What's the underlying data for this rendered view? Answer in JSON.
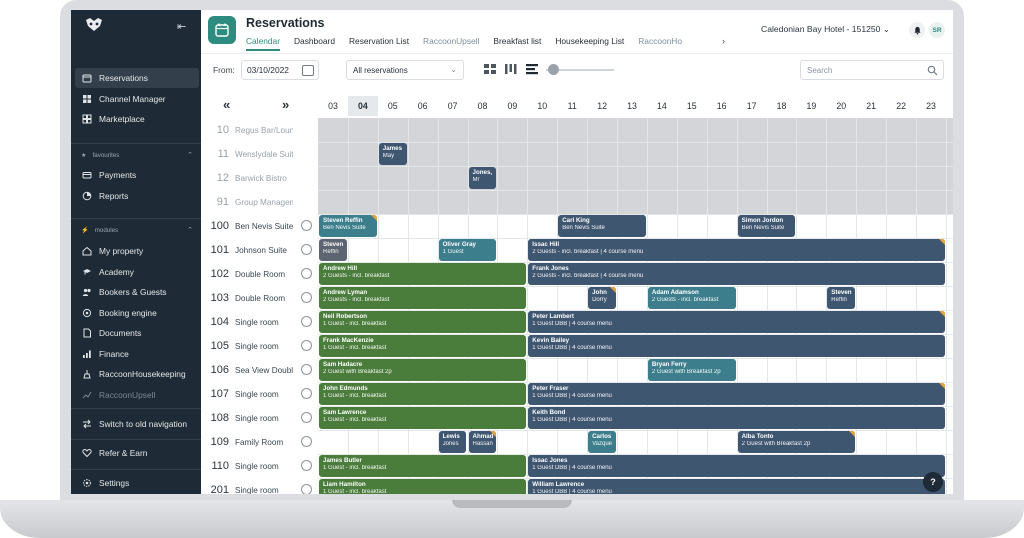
{
  "sidebar": {
    "nav": [
      {
        "label": "Reservations",
        "icon": "reservations-icon",
        "active": true
      },
      {
        "label": "Channel Manager",
        "icon": "channel-icon"
      },
      {
        "label": "Marketplace",
        "icon": "marketplace-icon"
      }
    ],
    "favourites_label": "favourites",
    "favourites": [
      {
        "label": "Payments",
        "icon": "payments-icon"
      },
      {
        "label": "Reports",
        "icon": "reports-icon"
      }
    ],
    "modules_label": "modules",
    "modules": [
      {
        "label": "My property",
        "icon": "property-icon"
      },
      {
        "label": "Academy",
        "icon": "academy-icon"
      },
      {
        "label": "Bookers & Guests",
        "icon": "guests-icon"
      },
      {
        "label": "Booking engine",
        "icon": "engine-icon"
      },
      {
        "label": "Documents",
        "icon": "documents-icon"
      },
      {
        "label": "Finance",
        "icon": "finance-icon"
      },
      {
        "label": "RaccoonHousekeeping",
        "icon": "housekeeping-icon"
      },
      {
        "label": "RaccoonUpsell",
        "icon": "upsell-icon",
        "dim": true
      }
    ],
    "footer": [
      {
        "label": "Switch to old navigation",
        "icon": "switch-icon"
      },
      {
        "label": "Refer & Earn",
        "icon": "heart-icon"
      },
      {
        "label": "Settings",
        "icon": "settings-icon"
      }
    ]
  },
  "header": {
    "title": "Reservations",
    "tabs": [
      {
        "label": "Calendar",
        "active": true
      },
      {
        "label": "Dashboard"
      },
      {
        "label": "Reservation List"
      },
      {
        "label": "RaccoonUpsell",
        "muted": true
      },
      {
        "label": "Breakfast list"
      },
      {
        "label": "Housekeeping List"
      },
      {
        "label": "RaccoonHo",
        "muted": true
      }
    ],
    "more": "›",
    "hotel": "Caledonian Bay Hotel - 151250",
    "avatar": "SR"
  },
  "toolbar": {
    "from_label": "From:",
    "from_value": "03/10/2022",
    "filter_value": "All reservations",
    "search_placeholder": "Search"
  },
  "calendar": {
    "prev": "«",
    "next": "»",
    "today_index": 1,
    "days": [
      "03",
      "04",
      "05",
      "06",
      "07",
      "08",
      "09",
      "10",
      "11",
      "12",
      "13",
      "14",
      "15",
      "16",
      "17",
      "18",
      "19",
      "20",
      "21",
      "22",
      "23"
    ],
    "rooms": [
      {
        "num": "10",
        "name": "Regus Bar/Lounge",
        "gray": true
      },
      {
        "num": "11",
        "name": "Wenslydale Suite",
        "gray": true
      },
      {
        "num": "12",
        "name": "Barwick Bistro",
        "gray": true
      },
      {
        "num": "91",
        "name": "Group Management",
        "gray": true
      },
      {
        "num": "100",
        "name": "Ben Nevis Suite"
      },
      {
        "num": "101",
        "name": "Johnson Suite"
      },
      {
        "num": "102",
        "name": "Double Room"
      },
      {
        "num": "103",
        "name": "Double Room"
      },
      {
        "num": "104",
        "name": "Single room"
      },
      {
        "num": "105",
        "name": "Single room"
      },
      {
        "num": "106",
        "name": "Sea View Double"
      },
      {
        "num": "107",
        "name": "Single room"
      },
      {
        "num": "108",
        "name": "Single room"
      },
      {
        "num": "109",
        "name": "Family Room"
      },
      {
        "num": "110",
        "name": "Single room"
      },
      {
        "num": "201",
        "name": "Single room"
      }
    ],
    "bookings": [
      {
        "row": 1,
        "start": 2,
        "span": 1,
        "color": "blue",
        "name": "James",
        "detail": "May"
      },
      {
        "row": 2,
        "start": 5,
        "span": 1,
        "color": "blue",
        "name": "Jones,",
        "detail": "Mr"
      },
      {
        "row": 4,
        "start": 0,
        "span": 2,
        "color": "teal",
        "name": "Steven Reffin",
        "detail": "Ben Nevis Suite",
        "flag": true
      },
      {
        "row": 4,
        "start": 8,
        "span": 3,
        "color": "blue",
        "name": "Carl King",
        "detail": "Ben Nevis Suite"
      },
      {
        "row": 4,
        "start": 14,
        "span": 2,
        "color": "blue",
        "name": "Simon Jordon",
        "detail": "Ben Nevis Suite"
      },
      {
        "row": 5,
        "start": 0,
        "span": 1,
        "color": "grey",
        "name": "Steven",
        "detail": "Reffin"
      },
      {
        "row": 5,
        "start": 4,
        "span": 2,
        "color": "teal",
        "name": "Oliver Gray",
        "detail": "1 Guest"
      },
      {
        "row": 5,
        "start": 7,
        "span": 14,
        "color": "blue",
        "name": "Issac Hill",
        "detail": "2 Guests - incl. breakfast | 4 course menu",
        "flag": true
      },
      {
        "row": 6,
        "start": 0,
        "span": 7,
        "color": "green",
        "name": "Andrew Hill",
        "detail": "2 Guests - incl. breakfast"
      },
      {
        "row": 6,
        "start": 7,
        "span": 14,
        "color": "blue",
        "name": "Frank Jones",
        "detail": "2 Guests - incl. breakfast | 4 course menu"
      },
      {
        "row": 7,
        "start": 0,
        "span": 7,
        "color": "green",
        "name": "Andrew Lyman",
        "detail": "2 Guests - incl. breakfast"
      },
      {
        "row": 7,
        "start": 9,
        "span": 1,
        "color": "blue",
        "name": "John",
        "detail": "Dorry",
        "flag": true
      },
      {
        "row": 7,
        "start": 11,
        "span": 3,
        "color": "teal",
        "name": "Adam Adamson",
        "detail": "2 Guests - incl. breakfast"
      },
      {
        "row": 7,
        "start": 17,
        "span": 1,
        "color": "blue",
        "name": "Steven",
        "detail": "Reffin"
      },
      {
        "row": 8,
        "start": 0,
        "span": 7,
        "color": "green",
        "name": "Neil Robertson",
        "detail": "1 Guest - incl. breakfast"
      },
      {
        "row": 8,
        "start": 7,
        "span": 14,
        "color": "blue",
        "name": "Peter Lambert",
        "detail": "1 Guest DBB | 4 course menu",
        "flag": true
      },
      {
        "row": 9,
        "start": 0,
        "span": 7,
        "color": "green",
        "name": "Frank MacKenzie",
        "detail": "1 Guest - incl. breakfast"
      },
      {
        "row": 9,
        "start": 7,
        "span": 14,
        "color": "blue",
        "name": "Kevin Bailey",
        "detail": "1 Guest DBB | 4 course menu"
      },
      {
        "row": 10,
        "start": 0,
        "span": 7,
        "color": "green",
        "name": "Sam Hadacre",
        "detail": "2 Guest with Breakfast 2p"
      },
      {
        "row": 10,
        "start": 11,
        "span": 3,
        "color": "teal",
        "name": "Bryan Ferry",
        "detail": "2 Guest with Breakfast 2p"
      },
      {
        "row": 11,
        "start": 0,
        "span": 7,
        "color": "green",
        "name": "John Edmunds",
        "detail": "1 Guest - incl. breakfast"
      },
      {
        "row": 11,
        "start": 7,
        "span": 14,
        "color": "blue",
        "name": "Peter Fraser",
        "detail": "1 Guest DBB | 4 course menu",
        "flag": true
      },
      {
        "row": 12,
        "start": 0,
        "span": 7,
        "color": "green",
        "name": "Sam Lawrence",
        "detail": "1 Guest - incl. breakfast"
      },
      {
        "row": 12,
        "start": 7,
        "span": 14,
        "color": "blue",
        "name": "Keith Bond",
        "detail": "1 Guest DBB | 4 course menu"
      },
      {
        "row": 13,
        "start": 4,
        "span": 1,
        "color": "blue",
        "name": "Lewis",
        "detail": "Jones"
      },
      {
        "row": 13,
        "start": 5,
        "span": 1,
        "color": "blue",
        "name": "Ahmad",
        "detail": "Hassan",
        "flag": true
      },
      {
        "row": 13,
        "start": 9,
        "span": 1,
        "color": "teal",
        "name": "Carlos",
        "detail": "Vazque"
      },
      {
        "row": 13,
        "start": 14,
        "span": 4,
        "color": "blue",
        "name": "Alba Tonto",
        "detail": "2 Guest with Breakfast 2p",
        "flag": true
      },
      {
        "row": 14,
        "start": 0,
        "span": 7,
        "color": "green",
        "name": "James Butler",
        "detail": "1 Guest - incl. breakfast"
      },
      {
        "row": 14,
        "start": 7,
        "span": 14,
        "color": "blue",
        "name": "Issac Jones",
        "detail": "1 Guest DBB | 4 course menu"
      },
      {
        "row": 15,
        "start": 0,
        "span": 7,
        "color": "green",
        "name": "Liam Hamilton",
        "detail": "1 Guest - incl. breakfast"
      },
      {
        "row": 15,
        "start": 7,
        "span": 14,
        "color": "blue",
        "name": "William Lawrence",
        "detail": "1 Guest DBB | 4 course menu"
      }
    ]
  },
  "help_label": "?"
}
